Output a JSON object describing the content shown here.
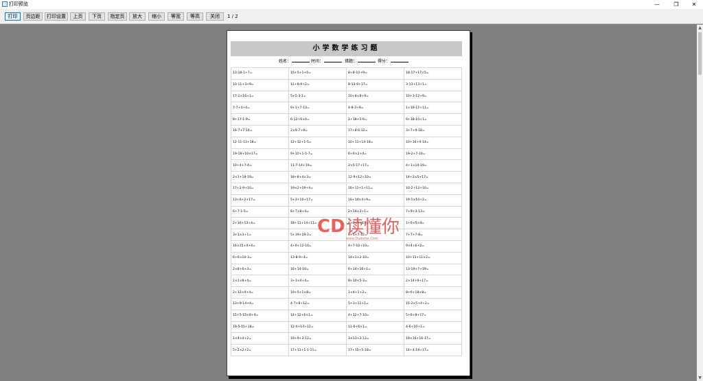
{
  "window": {
    "title": "打印预览",
    "minimize_glyph": "—",
    "maximize_glyph": "❐",
    "close_glyph": "✕"
  },
  "toolbar": {
    "buttons": [
      "打印",
      "页边距",
      "打印设置",
      "上页",
      "下页",
      "指定页",
      "放大",
      "缩小",
      "等宽",
      "等高",
      "关闭"
    ],
    "page_indicator": "1 / 2"
  },
  "scrollbar": {
    "up_glyph": "▲",
    "down_glyph": "▼"
  },
  "sheet": {
    "title": "小学数学练习题",
    "fields": [
      {
        "label": "姓名："
      },
      {
        "label": "时间："
      },
      {
        "label": "错题："
      },
      {
        "label": "得分："
      }
    ],
    "rows": [
      [
        "13-18-1+7=",
        "15+5+1+0=",
        "8+8-10+9=",
        "18-17+17×5="
      ],
      [
        "10-11+3+9=",
        "11+8-9+2=",
        "8-13-9+17=",
        "3-13+13+1="
      ],
      [
        "17-1×16+1=",
        "5+5-3-1=",
        "10+8×8+9=",
        "10+3-12+9="
      ],
      [
        "7-7+4+4=",
        "9+1+7-13=",
        "4-8-3+9=",
        "1+16-12+11="
      ],
      [
        "8+17-1-9=",
        "6-13+6×4=",
        "1+18+1-9=",
        "9+18-10+1="
      ],
      [
        "16-7+7-14=",
        "2×9-7+9=",
        "17+8-6-12=",
        "3+7+9-18="
      ],
      [
        "12-11-13+18=",
        "12+12+1-5=",
        "10+11+14-18=",
        "10+16+4-14="
      ],
      [
        "19-18+10×17=",
        "9+10+1-5-7=",
        "6+6×2+4=",
        "19-2+7-10="
      ],
      [
        "10+4+7-4=",
        "11-7-14+19=",
        "2×5-17+17=",
        "4+1×10-19="
      ],
      [
        "2×1+18-19=",
        "18+8+4×3=",
        "12-9+12+10=",
        "14+2×5+17="
      ],
      [
        "17+2-9+10=",
        "19×2+19+4=",
        "16+11+1+11=",
        "10-2+12+10="
      ],
      [
        "13+6+2+17=",
        "5+3+10+17=",
        "16+14×4+9=",
        "19-1×10+2="
      ],
      [
        "6+7-1-5=",
        "8+7×8+4=",
        "2+14×3+1=",
        "7+9+3-13="
      ],
      [
        "2+16+13+4=",
        "18+11+14+11=",
        "4+3×2+19=",
        "1+6×5×4="
      ],
      [
        "3+1×3+1=",
        "5+19+19-2=",
        "8+1+7-12=",
        "7+7+7-8="
      ],
      [
        "16×15+4+4=",
        "4+9+12-10=",
        "4+7-10+10=",
        "9×4+6+2="
      ],
      [
        "6+6×10-3=",
        "13-8-9+4=",
        "14×1×2-10=",
        "10+11+11×2="
      ],
      [
        "2×8+6×3=",
        "16+14-10=",
        "6+14+16+1=",
        "13-19×7+19="
      ],
      [
        "1×1×8+4=",
        "3+3×4+4=",
        "8+10×5-3=",
        "2×14+9+17="
      ],
      [
        "2+12×4+4=",
        "19+5+1×8=",
        "1×4+1+2=",
        "8+6+18×8="
      ],
      [
        "13+9-14+4=",
        "4-7+8+12=",
        "5+3+11+1=",
        "15-2×5+4+2="
      ],
      [
        "15+5-15×8+4=",
        "14+12+6×1=",
        "4+12+7-10=",
        "5+6+8+17="
      ],
      [
        "19-5-15+18=",
        "12-4+14+12=",
        "11-6+6×1=",
        "4-6+10+1="
      ],
      [
        "1×4×4+2=",
        "19+9+3-12=",
        "3×13+3-12=",
        "19×16+16-17="
      ],
      [
        "5+2×2+2=",
        "17+11+1-1-11=",
        "17+15+5-18=",
        "14+4-18+17="
      ]
    ]
  },
  "watermark": {
    "mark": "CD",
    "text": "读懂你",
    "url": "www.Dudotte.Com",
    "color": "#e0403a"
  }
}
